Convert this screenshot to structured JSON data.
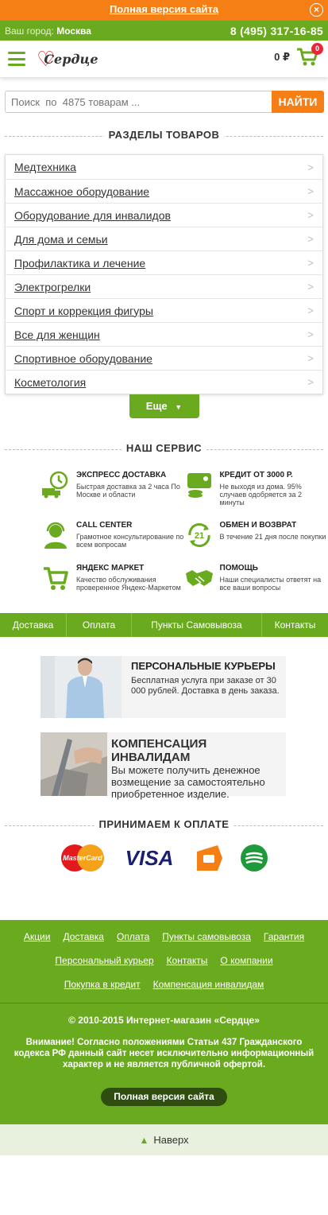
{
  "topbar": {
    "full_version_link": "Полная версия сайта",
    "close_glyph": "×"
  },
  "citybar": {
    "label": "Ваш город:",
    "city": "Москва",
    "phone": "8 (495) 317-16-85"
  },
  "header": {
    "logo_text": "Сердце",
    "cart_sum": "0 ₽",
    "cart_count": "0",
    "brand_color": "#6aaa1e",
    "accent_color": "#f57f14"
  },
  "search": {
    "placeholder": "Поиск  по  4875 товарам ...",
    "button": "НАЙТИ"
  },
  "categories": {
    "title": "РАЗДЕЛЫ ТОВАРОВ",
    "items": [
      "Медтехника",
      "Массажное оборудование",
      "Оборудование для инвалидов",
      "Для дома и семьи",
      "Профилактика и лечение",
      "Электрогрелки",
      "Спорт и коррекция фигуры",
      "Все для женщин",
      "Спортивное оборудование",
      "Косметология"
    ],
    "more_button": "Еще"
  },
  "service": {
    "title": "НАШ СЕРВИС",
    "items": [
      {
        "icon": "truck-clock-icon",
        "title": "ЭКСПРЕСС ДОСТАВКА",
        "text": "Быстрая доставка за 2 часа По Москве и области"
      },
      {
        "icon": "credit-card-icon",
        "title": "КРЕДИТ ОТ 3000 Р.",
        "text": "Не выходя из дома. 95% случаев одобряется за 2 минуты"
      },
      {
        "icon": "headset-operator-icon",
        "title": "CALL CENTER",
        "text": "Грамотное консультирование по всем вопросам"
      },
      {
        "icon": "return-21-icon",
        "title": "ОБМЕН И ВОЗВРАТ",
        "text": "В течение 21 дня после покупки"
      },
      {
        "icon": "market-cart-icon",
        "title": "ЯНДЕКС МАРКЕТ",
        "text": "Качество обслуживания проверенное Яндекс-Маркетом"
      },
      {
        "icon": "handshake-icon",
        "title": "ПОМОЩЬ",
        "text": "Наши специалисты ответят на все ваши вопросы"
      }
    ]
  },
  "navbar": {
    "items": [
      "Доставка",
      "Оплата",
      "Пункты Самовывоза",
      "Контакты"
    ]
  },
  "promos": [
    {
      "title": "ПЕРСОНАЛЬНЫЕ КУРЬЕРЫ",
      "text": "Бесплатная услуга при заказе от 30 000 рублей. Доставка в день заказа."
    },
    {
      "title": "КОМПЕНСАЦИЯ ИНВАЛИДАМ",
      "text": "Вы можете получить денежное возмещение за самостоятельно приобретенное изделие."
    }
  ],
  "payment": {
    "title": "ПРИНИМАЕМ К ОПЛАТЕ",
    "mastercard": "MasterCard",
    "visa": "VISA"
  },
  "footer": {
    "links_row1": [
      "Акции",
      "Доставка",
      "Оплата",
      "Пункты самовывоза",
      "Гарантия"
    ],
    "links_row2": [
      "Персональный курьер",
      "Контакты",
      "О компании"
    ],
    "links_row3": [
      "Покупка в кредит",
      "Компенсация инвалидам"
    ],
    "copyright": "© 2010-2015 Интернет-магазин «Сердце»",
    "warning": "Внимание! Согласно положениями Статьи 437 Гражданского кодекса РФ данный сайт несет исключительно информационный характер и не является публичной офертой.",
    "full_version_button": "Полная версия сайта",
    "to_top": "Наверх"
  }
}
